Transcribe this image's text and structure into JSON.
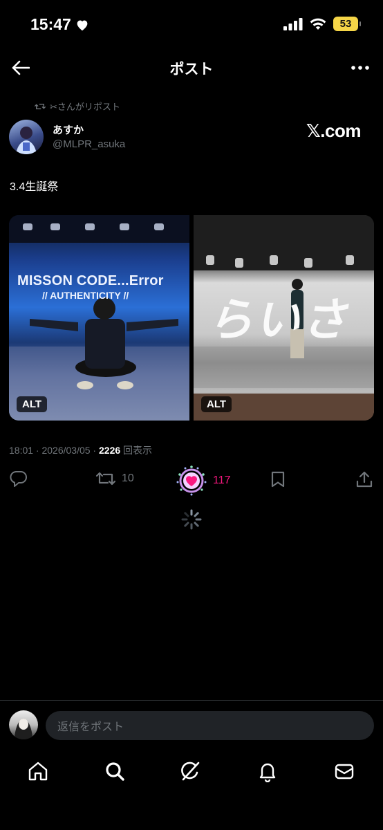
{
  "status_bar": {
    "time": "15:47",
    "battery": "53"
  },
  "header": {
    "title": "ポスト"
  },
  "repost": {
    "text": "✂︎さんがリポスト"
  },
  "author": {
    "display_name": "あすか",
    "handle": "@MLPR_asuka",
    "watermark": "𝕏.com"
  },
  "post": {
    "text": "3.4生誕祭"
  },
  "media": [
    {
      "alt_label": "ALT",
      "overlay_line1": "MISSON CODE...Error",
      "overlay_line2": "// AUTHENTICITY //"
    },
    {
      "alt_label": "ALT",
      "overlay_text": "らいさ"
    }
  ],
  "meta": {
    "time_date": "18:01 · 2026/03/05 · ",
    "views_count": "2226",
    "views_label": " 回表示"
  },
  "actions": {
    "retweet_count": "10",
    "like_count": "117"
  },
  "reply": {
    "placeholder": "返信をポスト"
  },
  "colors": {
    "background": "#000000",
    "like": "#f91880",
    "muted": "#71767b",
    "battery": "#f5d547"
  }
}
